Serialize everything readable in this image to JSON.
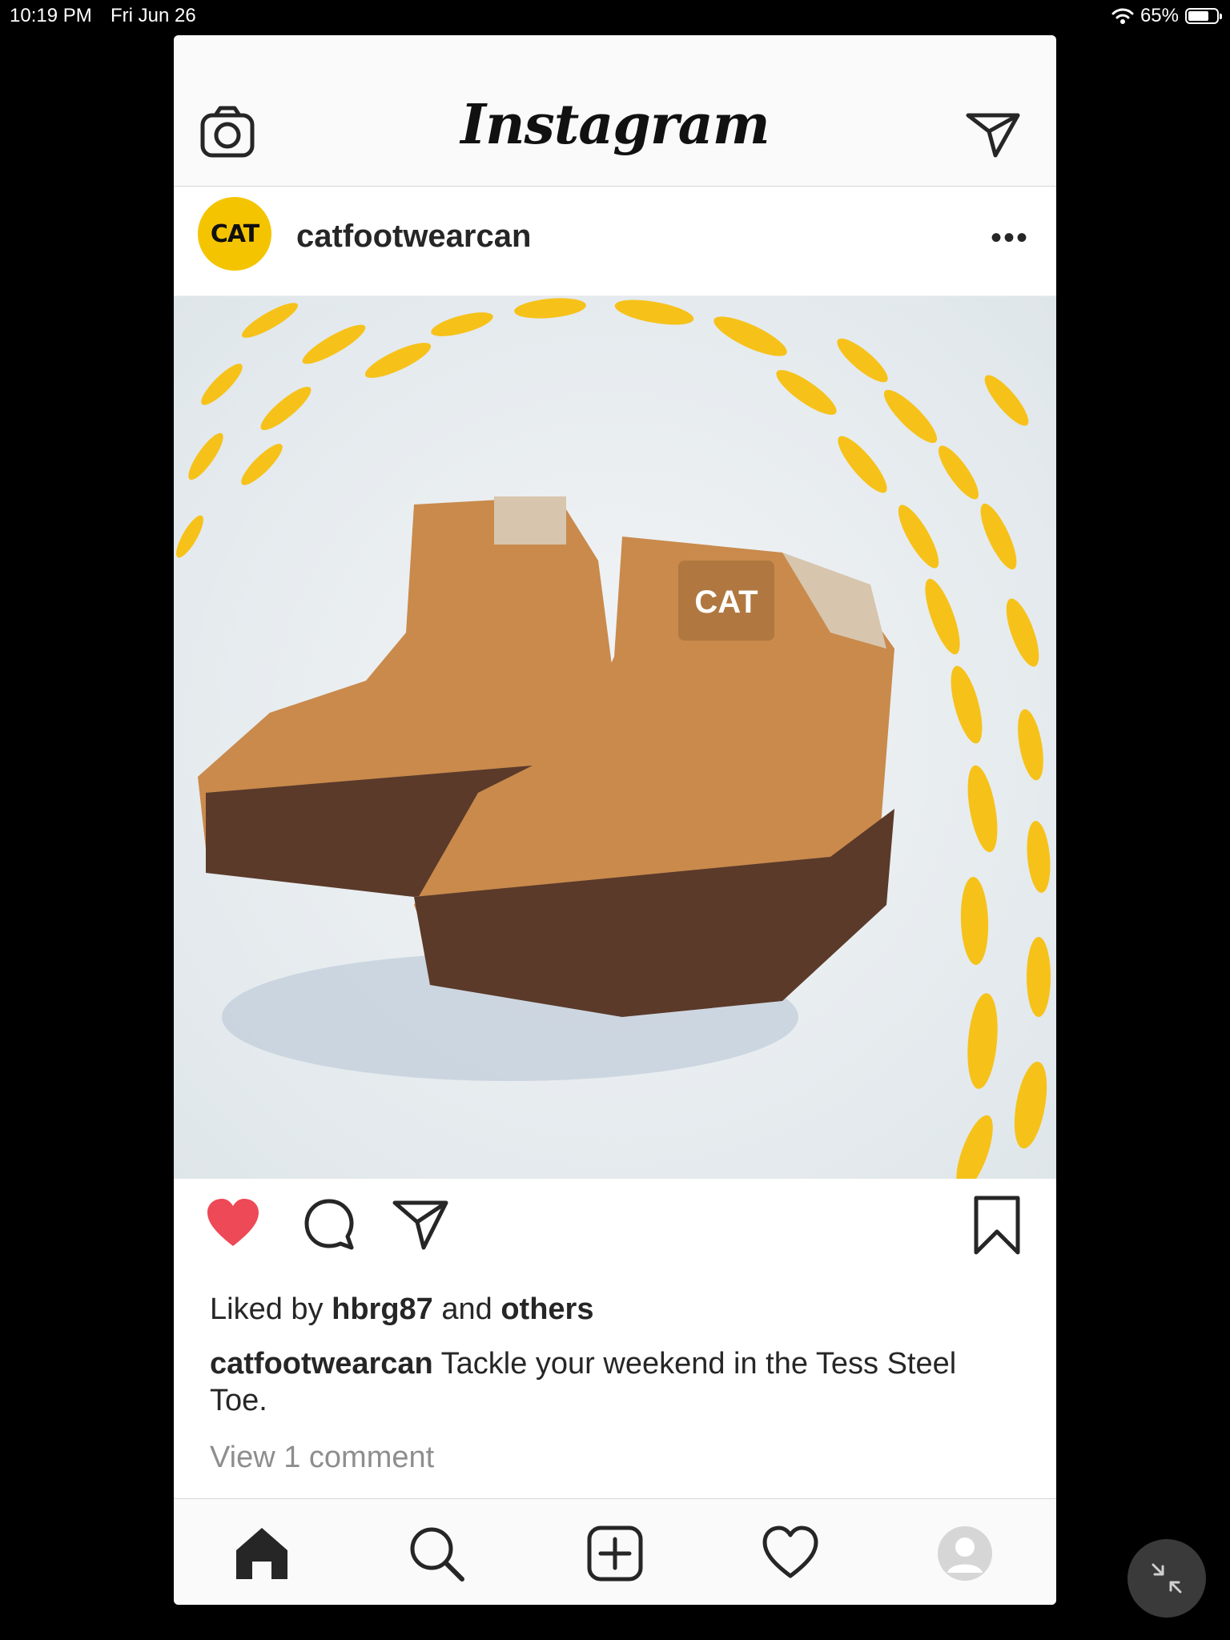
{
  "status": {
    "time": "10:19 PM",
    "date": "Fri Jun 26",
    "battery": "65%",
    "battery_level": 0.65
  },
  "header": {
    "logo": "Instagram",
    "icons": [
      "camera-icon",
      "direct-message-icon"
    ]
  },
  "post": {
    "username": "catfootwearcan",
    "avatar_text": "CAT",
    "more_label": "•••",
    "liked_by_prefix": "Liked by",
    "liked_by_user": "hbrg87",
    "liked_by_and": "and",
    "liked_by_others": "others",
    "caption_user": "catfootwearcan",
    "caption_text": "Tackle your weekend in the Tess Steel Toe.",
    "view_comments": "View 1 comment",
    "liked": true
  },
  "colors": {
    "like_red": "#ed4956",
    "brand_yellow": "#f5c400",
    "boot_tan": "#c98a4c",
    "sole_brown": "#5b3a2a"
  },
  "tabbar": {
    "items": [
      "home-icon",
      "search-icon",
      "new-post-icon",
      "activity-icon",
      "profile-icon"
    ]
  }
}
